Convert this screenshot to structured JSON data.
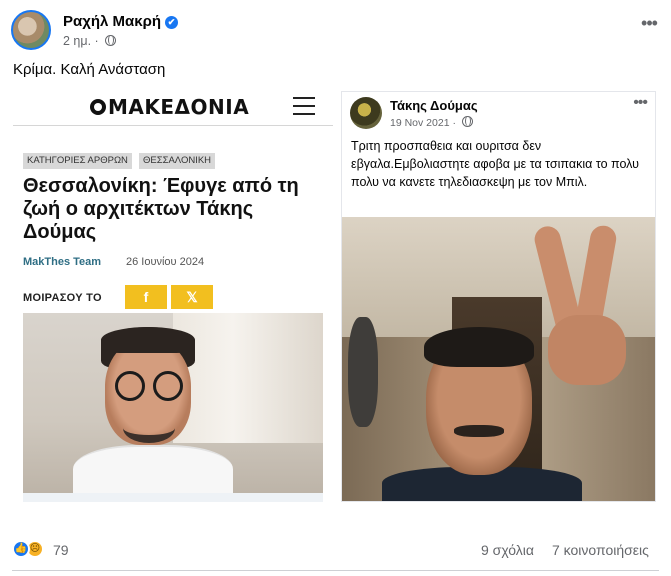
{
  "post": {
    "author": "Ραχήλ Μακρή",
    "time": "2 ημ.",
    "verified_mark": "✔",
    "more_label": "•••",
    "text": "Κρίμα. Καλή Ανάσταση"
  },
  "article": {
    "site_name": "ΜΑΚΕΔΟΝΙΑ",
    "tags": [
      "ΚΑΤΗΓΟΡΙΕΣ ΑΡΘΡΩΝ",
      "ΘΕΣΣΑΛΟΝΙΚΗ"
    ],
    "title": "Θεσσαλονίκη: Έφυγε από τη ζωή ο αρχιτέκτων Τάκης Δούμας",
    "author": "MakThes Team",
    "date": "26 Ιουνίου 2024",
    "share_label": "ΜΟΙΡΑΣΟΥ ΤΟ",
    "share_buttons": [
      "f",
      "𝕏"
    ]
  },
  "inner_post": {
    "author": "Τάκης Δούμας",
    "time": "19 Nov 2021",
    "more_label": "•••",
    "text": "Τριτη προσπαθεια και ουριτσα δεν εβγαλα.Εμβολιαστητε αφοβα με τα τσιπακια το πολυ πολυ να κανετε τηλεδιασκεψη με τον Μπιλ."
  },
  "footer": {
    "reaction_count": "79",
    "comments": "9 σχόλια",
    "shares": "7 κοινοποιήσεις",
    "reaction_icons": [
      "like-icon",
      "sad-icon"
    ]
  },
  "colors": {
    "facebook_blue": "#1877f2",
    "share_yellow": "#f2bf1f",
    "meta_gray": "#65676b",
    "byline_teal": "#2f6e84"
  }
}
